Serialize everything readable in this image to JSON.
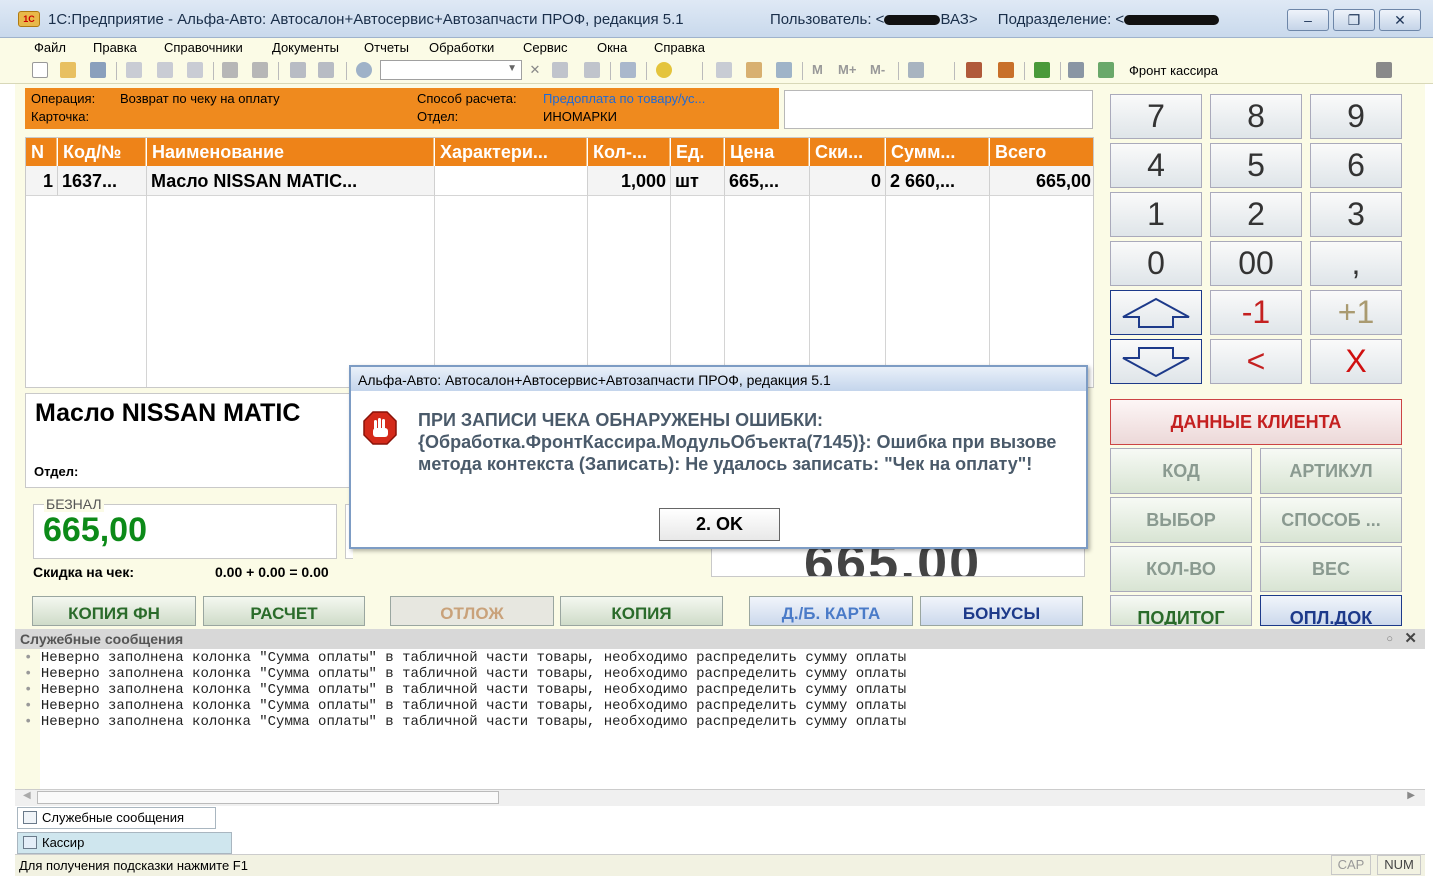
{
  "window": {
    "title": "1С:Предприятие - Альфа-Авто: Автосалон+Автосервис+Автозапчасти ПРОФ, редакция 5.1",
    "user_label": "Пользователь: <",
    "user_suffix": "ВАЗ>",
    "division_label": "Подразделение: <",
    "logo": "1С"
  },
  "menu": [
    "Файл",
    "Правка",
    "Справочники",
    "Документы",
    "Отчеты",
    "Обработки",
    "Сервис",
    "Окна",
    "Справка"
  ],
  "toolbar": {
    "front_label": "Фронт кассира",
    "memory_buttons": [
      "M",
      "M+",
      "M-"
    ]
  },
  "operation": {
    "operation_label": "Операция:",
    "operation_value": "Возврат по чеку на оплату",
    "card_label": "Карточка:",
    "payment_method_label": "Способ расчета:",
    "payment_method_value": "Предоплата по товару/ус...",
    "department_label": "Отдел:",
    "department_value": "ИНОМАРКИ"
  },
  "grid": {
    "columns": [
      "N",
      "Код/№",
      "Наименование",
      "Характери...",
      "Кол-...",
      "Ед.",
      "Цена",
      "Ски...",
      "Сумм...",
      "Всего"
    ],
    "rows": [
      [
        "1",
        "1637...",
        "Масло NISSAN MATIC...",
        "",
        "1,000",
        "шт",
        "665,...",
        "0",
        "2 660,...",
        "665,00"
      ]
    ]
  },
  "item_panel": {
    "name": "Масло NISSAN MATIC",
    "department_label": "Отдел:"
  },
  "payment": {
    "label": "БЕЗНАЛ",
    "value": "665,00",
    "discount_label": "Скидка на чек:",
    "discount_value": "0.00 + 0.00 = 0.00",
    "total_value": "665,00"
  },
  "function_buttons": [
    "КОПИЯ ФН",
    "РАСЧЕТ",
    "ОТЛОЖ",
    "КОПИЯ",
    "Д./Б. КАРТА",
    "БОНУСЫ"
  ],
  "keypad": {
    "keys": [
      "7",
      "8",
      "9",
      "4",
      "5",
      "6",
      "1",
      "2",
      "3",
      "0",
      "00",
      ","
    ],
    "minus_one": "-1",
    "plus_one": "+1",
    "backspace": "<",
    "clear": "X",
    "client_data": "ДАННЫЕ КЛИЕНТА",
    "code": "КОД",
    "article": "АРТИКУЛ",
    "choice": "ВЫБОР",
    "method": "СПОСОБ ...",
    "quantity": "КОЛ-ВО",
    "weight": "ВЕС",
    "subtotal": "ПОДИТОГ",
    "pay_doc": "ОПЛ.ДОК"
  },
  "dialog": {
    "title": "Альфа-Авто: Автосалон+Автосервис+Автозапчасти ПРОФ, редакция 5.1",
    "message": "ПРИ ЗАПИСИ ЧЕКА ОБНАРУЖЕНЫ ОШИБКИ: {Обработка.ФронтКассира.МодульОбъекта(7145)}: Ошибка при вызове метода контекста (Записать): Не удалось записать: \"Чек на оплату\"!",
    "ok_label": "2. OK"
  },
  "messages": {
    "title": "Служебные сообщения",
    "lines": [
      "Неверно заполнена колонка \"Сумма оплаты\" в табличной части товары, необходимо распределить сумму оплаты",
      "Неверно заполнена колонка \"Сумма оплаты\" в табличной части товары, необходимо распределить сумму оплаты",
      "Неверно заполнена колонка \"Сумма оплаты\" в табличной части товары, необходимо распределить сумму оплаты",
      "Неверно заполнена колонка \"Сумма оплаты\" в табличной части товары, необходимо распределить сумму оплаты",
      "Неверно заполнена колонка \"Сумма оплаты\" в табличной части товары, необходимо распределить сумму оплаты"
    ]
  },
  "taskbar": {
    "tabs": [
      "Служебные сообщения",
      "Кассир"
    ]
  },
  "status": {
    "hint": "Для получения подсказки нажмите F1",
    "cap": "CAP",
    "num": "NUM"
  }
}
